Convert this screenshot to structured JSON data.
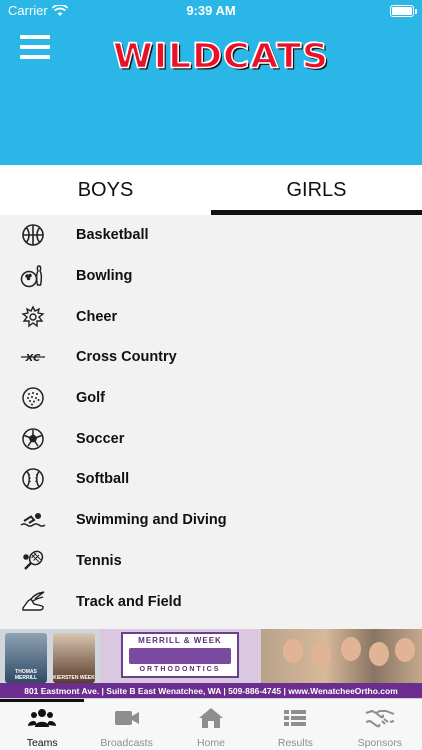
{
  "status_bar": {
    "carrier": "Carrier",
    "time": "9:39 AM"
  },
  "header": {
    "logo_text": "WILDCATS",
    "menu_icon": "hamburger-menu-icon",
    "background": "#2bb6e8",
    "logo_color": "#e8102a"
  },
  "tabs": [
    {
      "label": "BOYS",
      "active": false
    },
    {
      "label": "GIRLS",
      "active": true
    }
  ],
  "sports": [
    {
      "label": "Basketball",
      "icon": "basketball-icon"
    },
    {
      "label": "Bowling",
      "icon": "bowling-icon"
    },
    {
      "label": "Cheer",
      "icon": "cheer-pompom-icon"
    },
    {
      "label": "Cross Country",
      "icon": "cross-country-icon",
      "icon_text": "XC"
    },
    {
      "label": "Golf",
      "icon": "golf-ball-icon"
    },
    {
      "label": "Soccer",
      "icon": "soccer-ball-icon"
    },
    {
      "label": "Softball",
      "icon": "softball-icon"
    },
    {
      "label": "Swimming and Diving",
      "icon": "swimmer-icon"
    },
    {
      "label": "Tennis",
      "icon": "tennis-racket-icon"
    },
    {
      "label": "Track and Field",
      "icon": "winged-shoe-icon"
    }
  ],
  "ad": {
    "person1": "THOMAS MERRILL",
    "person2": "KIERSTEN WEEK",
    "logo_top": "MERRILL & WEEK",
    "logo_bottom": "ORTHODONTICS",
    "footer": "801 Eastmont Ave. | Suite B East Wenatchee, WA | 509-886-4745 | www.WenatcheeOrtho.com",
    "accent": "#6b2d8e"
  },
  "tabbar": [
    {
      "label": "Teams",
      "icon": "teams-icon",
      "active": true
    },
    {
      "label": "Broadcasts",
      "icon": "video-camera-icon",
      "active": false
    },
    {
      "label": "Home",
      "icon": "home-icon",
      "active": false
    },
    {
      "label": "Results",
      "icon": "list-icon",
      "active": false
    },
    {
      "label": "Sponsors",
      "icon": "handshake-icon",
      "active": false
    }
  ]
}
